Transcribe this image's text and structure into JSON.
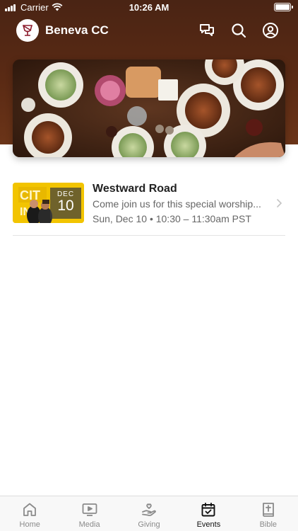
{
  "status_bar": {
    "carrier": "Carrier",
    "time": "10:26 AM"
  },
  "app": {
    "title": "Beneva CC"
  },
  "header_icons": [
    "chat-icon",
    "search-icon",
    "profile-icon"
  ],
  "events": [
    {
      "title": "Westward Road",
      "description": "Come join us for this special worship...",
      "schedule": "Sun, Dec 10 • 10:30 – 11:30am PST",
      "badge_month": "DEC",
      "badge_day": "10"
    }
  ],
  "tabs": [
    {
      "label": "Home",
      "icon": "home-icon",
      "active": false
    },
    {
      "label": "Media",
      "icon": "media-icon",
      "active": false
    },
    {
      "label": "Giving",
      "icon": "giving-icon",
      "active": false
    },
    {
      "label": "Events",
      "icon": "calendar-icon",
      "active": true
    },
    {
      "label": "Bible",
      "icon": "bible-icon",
      "active": false
    }
  ],
  "colors": {
    "header": "#5a2a14",
    "accent_yellow": "#f2c400",
    "text_muted": "#666666"
  }
}
